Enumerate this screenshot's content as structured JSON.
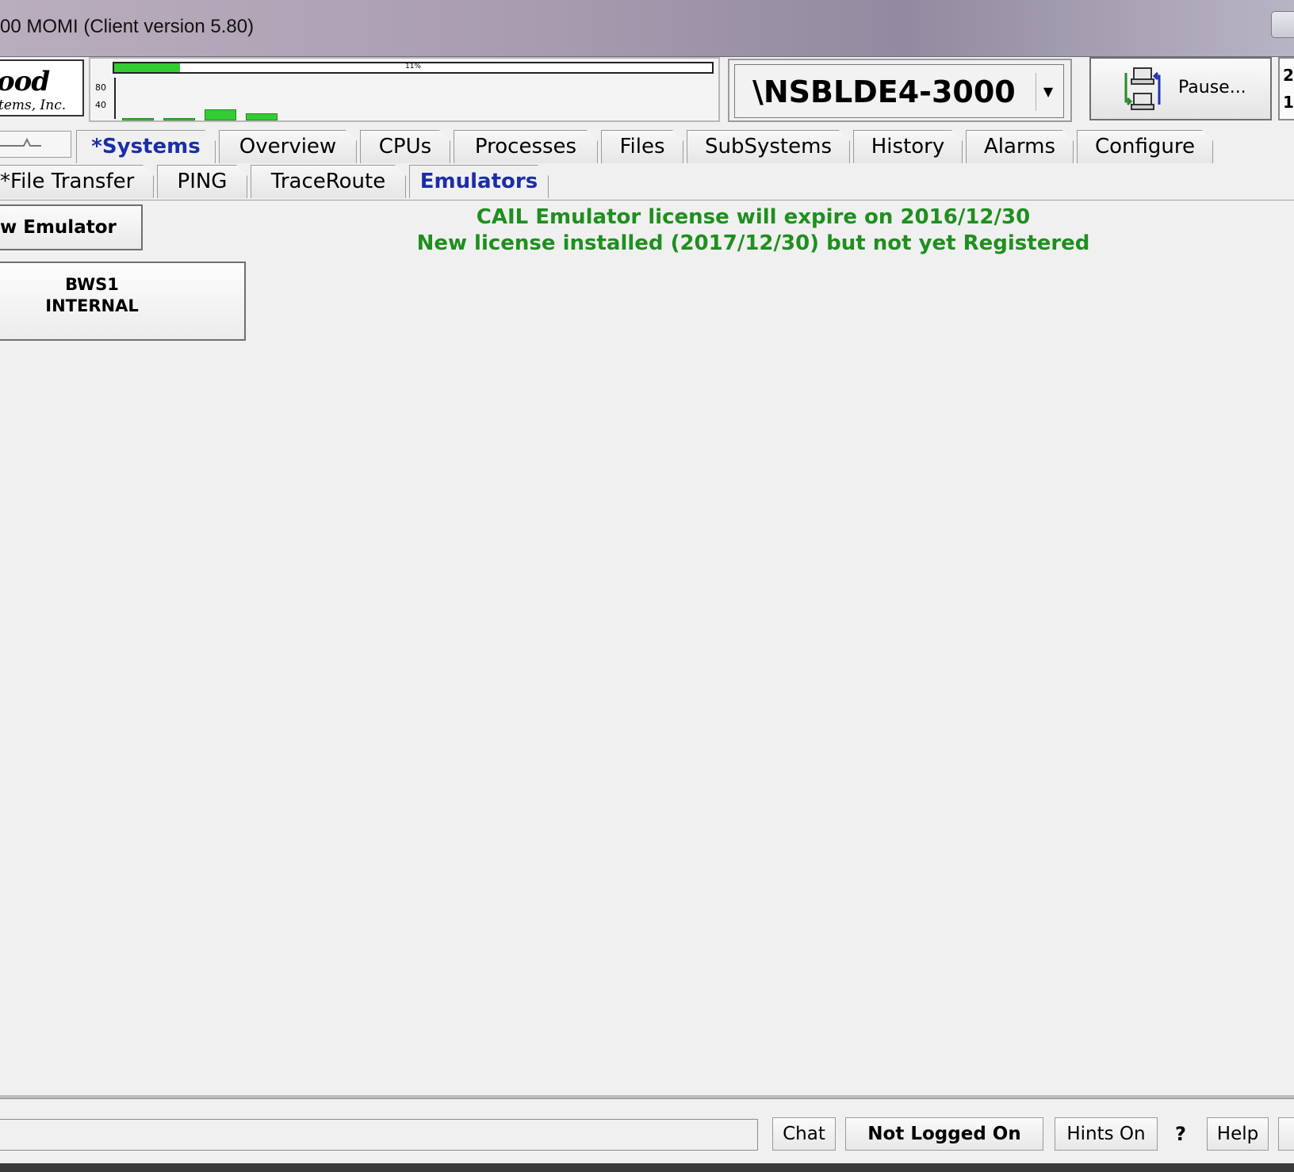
{
  "window": {
    "title": "00 MOMI (Client version 5.80)"
  },
  "logo": {
    "line1": "ood",
    "line2": "tems, Inc."
  },
  "graph": {
    "progress_percent": 11,
    "progress_label": "11%",
    "axis_labels": [
      "80",
      "40"
    ],
    "bar_values": [
      2,
      2,
      12,
      8
    ]
  },
  "system": {
    "name": "\\NSBLDE4-3000",
    "dropdown_icon": "chevron-down-icon"
  },
  "pause_button": {
    "label": "Pause..."
  },
  "edge_box": {
    "line1": "2",
    "line2": "1"
  },
  "tabs_primary": [
    {
      "label": "*Systems",
      "active": true
    },
    {
      "label": "Overview"
    },
    {
      "label": "CPUs"
    },
    {
      "label": "Processes"
    },
    {
      "label": "Files"
    },
    {
      "label": "SubSystems"
    },
    {
      "label": "History"
    },
    {
      "label": "Alarms"
    },
    {
      "label": "Configure"
    }
  ],
  "tabs_secondary": [
    {
      "label": "*File Transfer"
    },
    {
      "label": "PING"
    },
    {
      "label": "TraceRoute"
    },
    {
      "label": "Emulators",
      "selected": true
    }
  ],
  "main": {
    "new_emulator_label": "w Emulator",
    "emulator_line1": "BWS1",
    "emulator_line2": "INTERNAL",
    "license_line1": "CAIL Emulator license will expire on 2016/12/30",
    "license_line2": "New license installed (2017/12/30) but not yet Registered"
  },
  "statusbar": {
    "chat": "Chat",
    "login": "Not Logged On",
    "hints": "Hints On",
    "question": "?",
    "help": "Help"
  },
  "colors": {
    "accent": "#1b2ea8",
    "license_text": "#1f8f1f",
    "graph_green": "#33cc33"
  }
}
